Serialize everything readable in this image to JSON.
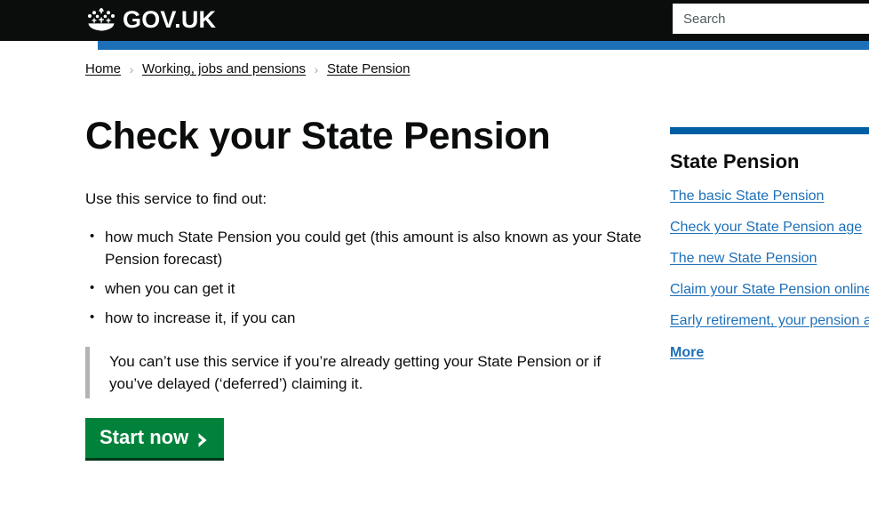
{
  "header": {
    "logo_text": "GOV.UK",
    "crown_icon": "crown-icon",
    "search": {
      "placeholder": "Search",
      "value": ""
    },
    "accent_blue": "#1d70b8",
    "background": "#0b0c0c"
  },
  "breadcrumb": {
    "items": [
      {
        "label": "Home"
      },
      {
        "label": "Working, jobs and pensions"
      },
      {
        "label": "State Pension"
      }
    ],
    "separator": "›"
  },
  "main": {
    "title": "Check your State Pension",
    "lead": "Use this service to find out:",
    "bullets": [
      "how much State Pension you could get (this amount is also known as your State Pension forecast)",
      "when you can get it",
      "how to increase it, if you can"
    ],
    "inset_text": "You can’t use this service if you’re already getting your State Pension or if you’ve delayed (‘deferred’) claiming it.",
    "start_button": {
      "label": "Start now",
      "icon": "chevron-right-icon",
      "color": "#00823b"
    }
  },
  "sidebar": {
    "rule_color": "#005ea5",
    "heading": "State Pension",
    "links": [
      "The basic State Pension",
      "Check your State Pension age",
      "The new State Pension",
      "Claim your State Pension online",
      "Early retirement, your pension and benefits"
    ],
    "more_label": "More"
  }
}
